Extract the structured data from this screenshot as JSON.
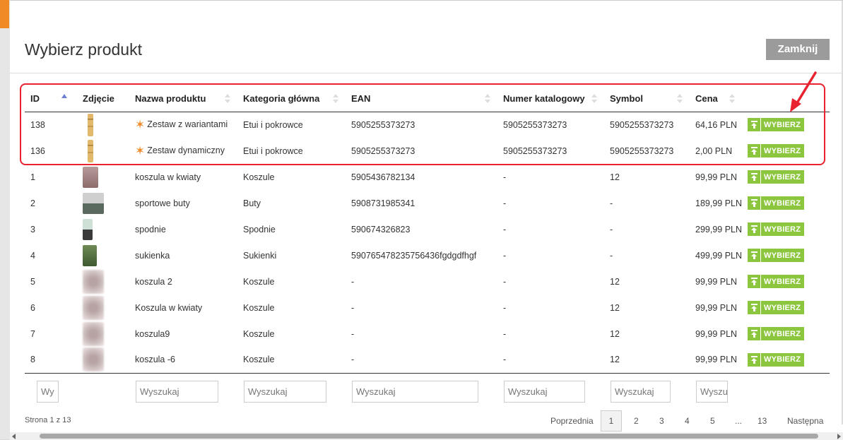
{
  "modal": {
    "title": "Wybierz produkt",
    "close_label": "Zamknij"
  },
  "table": {
    "headers": {
      "id": "ID",
      "photo": "Zdjęcie",
      "name": "Nazwa produktu",
      "category": "Kategoria główna",
      "ean": "EAN",
      "catalog": "Numer katalogowy",
      "symbol": "Symbol",
      "price": "Cena"
    },
    "pick_label": "WYBIERZ",
    "rows": [
      {
        "id": "138",
        "photo": "bamboo",
        "starred": true,
        "name": "Zestaw z wariantami",
        "category": "Etui i pokrowce",
        "ean": "5905255373273",
        "catalog": "5905255373273",
        "symbol": "5905255373273",
        "price": "64,16 PLN"
      },
      {
        "id": "136",
        "photo": "bamboo",
        "starred": true,
        "name": "Zestaw dynamiczny",
        "category": "Etui i pokrowce",
        "ean": "5905255373273",
        "catalog": "5905255373273",
        "symbol": "5905255373273",
        "price": "2,00 PLN"
      },
      {
        "id": "1",
        "photo": "shirt1",
        "starred": false,
        "name": "koszula w kwiaty",
        "category": "Koszule",
        "ean": "5905436782134",
        "catalog": "-",
        "symbol": "12",
        "price": "99,99 PLN"
      },
      {
        "id": "2",
        "photo": "shoes",
        "starred": false,
        "name": "sportowe buty",
        "category": "Buty",
        "ean": "5908731985341",
        "catalog": "-",
        "symbol": "-",
        "price": "189,99 PLN"
      },
      {
        "id": "3",
        "photo": "pants",
        "starred": false,
        "name": "spodnie",
        "category": "Spodnie",
        "ean": "590674326823",
        "catalog": "-",
        "symbol": "-",
        "price": "299,99 PLN"
      },
      {
        "id": "4",
        "photo": "dress",
        "starred": false,
        "name": "sukienka",
        "category": "Sukienki",
        "ean": "590765478235756436fgdgdfhgf",
        "catalog": "-",
        "symbol": "-",
        "price": "499,99 PLN"
      },
      {
        "id": "5",
        "photo": "blur",
        "starred": false,
        "name": "koszula 2",
        "category": "Koszule",
        "ean": "-",
        "catalog": "-",
        "symbol": "12",
        "price": "99,99 PLN"
      },
      {
        "id": "6",
        "photo": "blur",
        "starred": false,
        "name": "Koszula w kwiaty",
        "category": "Koszule",
        "ean": "-",
        "catalog": "-",
        "symbol": "12",
        "price": "99,99 PLN"
      },
      {
        "id": "7",
        "photo": "blur",
        "starred": false,
        "name": "koszula9",
        "category": "Koszule",
        "ean": "-",
        "catalog": "-",
        "symbol": "12",
        "price": "99,99 PLN"
      },
      {
        "id": "8",
        "photo": "blur",
        "starred": false,
        "name": "koszula -6",
        "category": "Koszule",
        "ean": "-",
        "catalog": "-",
        "symbol": "12",
        "price": "99,99 PLN"
      }
    ]
  },
  "filters": {
    "id_placeholder": "Wy",
    "name_placeholder": "Wyszukaj",
    "category_placeholder": "Wyszukaj",
    "ean_placeholder": "Wyszukaj",
    "catalog_placeholder": "Wyszukaj",
    "symbol_placeholder": "Wyszukaj",
    "price_placeholder": "Wyszukaj"
  },
  "pagination": {
    "info": "Strona 1 z 13",
    "prev": "Poprzednia",
    "pages": [
      "1",
      "2",
      "3",
      "4",
      "5",
      "...",
      "13"
    ],
    "current": "1",
    "next": "Następna"
  },
  "accent_colors": {
    "pick_button": "#8cc63f",
    "highlight": "#e8232f",
    "star": "#ef8a2a",
    "close_button": "#9b9b9b"
  }
}
